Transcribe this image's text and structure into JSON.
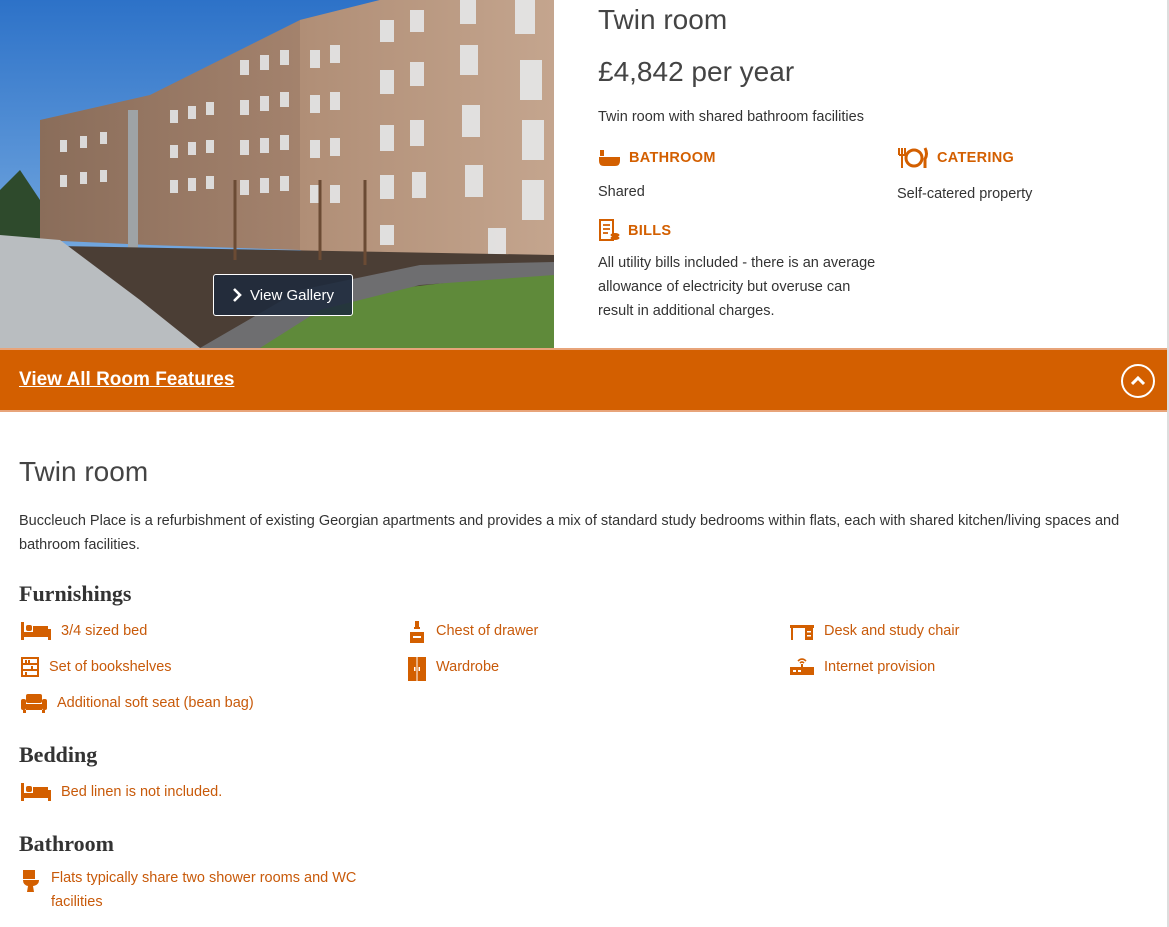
{
  "room": {
    "title": "Twin room",
    "price": "£4,842 per year",
    "description": "Twin room with shared bathroom facilities"
  },
  "gallery_button": {
    "label": "View Gallery",
    "icon": "chevron-right-icon"
  },
  "features": {
    "bathroom": {
      "label": "BATHROOM",
      "value": "Shared",
      "icon": "bath-icon"
    },
    "catering": {
      "label": "CATERING",
      "value": "Self-catered property",
      "icon": "plate-cutlery-icon"
    },
    "bills": {
      "label": "BILLS",
      "value": "All utility bills included - there is an average allowance of electricity but overuse can result in additional charges.",
      "icon": "bills-icon"
    }
  },
  "features_bar": {
    "link": "View All Room Features",
    "toggle_icon": "chevron-up-icon"
  },
  "details": {
    "title": "Twin room",
    "description": "Buccleuch Place is a refurbishment of existing Georgian apartments and provides a mix of standard study bedrooms within flats, each with shared kitchen/living spaces and bathroom facilities.",
    "furnishings": {
      "heading": "Furnishings",
      "items": [
        {
          "label": "3/4 sized bed",
          "icon": "bed-icon"
        },
        {
          "label": "Chest of drawer",
          "icon": "drawers-icon"
        },
        {
          "label": "Desk and study chair",
          "icon": "desk-icon"
        },
        {
          "label": "Set of bookshelves",
          "icon": "bookshelf-icon"
        },
        {
          "label": "Wardrobe",
          "icon": "wardrobe-icon"
        },
        {
          "label": "Internet provision",
          "icon": "router-icon"
        },
        {
          "label": "Additional soft seat (bean bag)",
          "icon": "sofa-icon"
        }
      ]
    },
    "bedding": {
      "heading": "Bedding",
      "items": [
        {
          "label": "Bed linen is not included.",
          "icon": "bed-icon"
        }
      ]
    },
    "bathroom": {
      "heading": "Bathroom",
      "items": [
        {
          "label": "Flats typically share two shower rooms and WC facilities",
          "icon": "toilet-icon"
        }
      ]
    }
  },
  "colors": {
    "accent": "#d35f00",
    "link": "#c85a0a",
    "text": "#333333"
  }
}
